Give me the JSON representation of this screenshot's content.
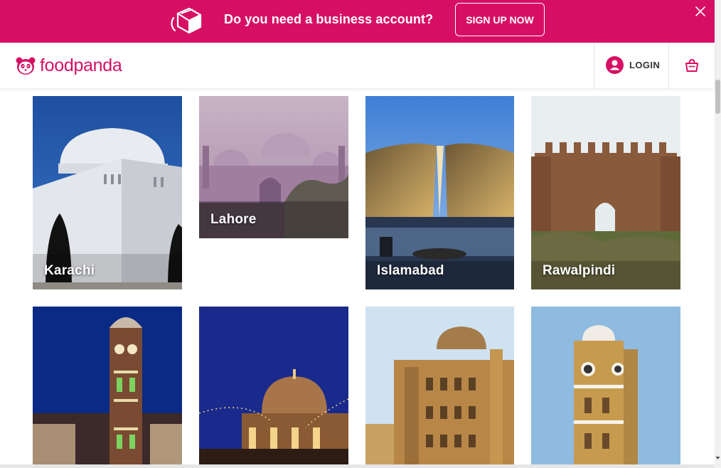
{
  "promo": {
    "text": "Do you need a business account?",
    "cta": "SIGN UP NOW"
  },
  "header": {
    "brand": "foodpanda",
    "login": "LOGIN"
  },
  "cities": [
    {
      "name": "Karachi"
    },
    {
      "name": "Lahore"
    },
    {
      "name": "Islamabad"
    },
    {
      "name": "Rawalpindi"
    },
    {
      "name": ""
    },
    {
      "name": ""
    },
    {
      "name": ""
    },
    {
      "name": ""
    }
  ],
  "colors": {
    "brand": "#d70f64",
    "header_bg": "#ffffff"
  },
  "icons": [
    "delivery-bag-icon",
    "close-icon",
    "panda-logo-icon",
    "user-icon",
    "shopping-bag-icon"
  ]
}
